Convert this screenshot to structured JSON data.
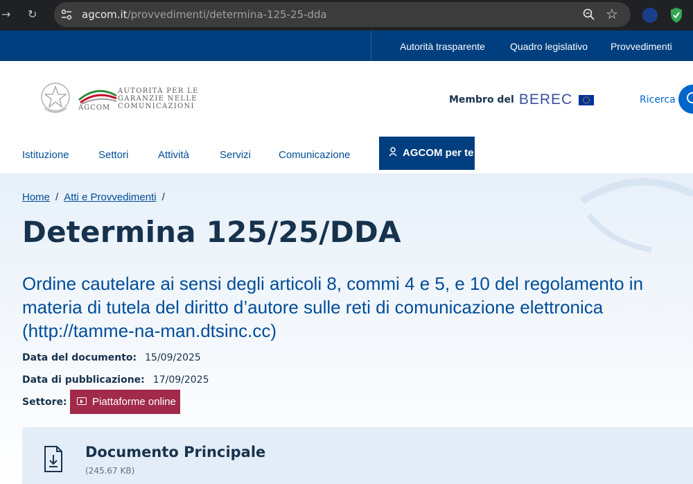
{
  "browser": {
    "url_host": "agcom.it",
    "url_path": "/provvedimenti/determina-125-25-dda"
  },
  "topbar": {
    "links": [
      "Autorità trasparente",
      "Quadro legislativo",
      "Provvedimenti"
    ]
  },
  "header": {
    "logo_lines": [
      "AUTORITÀ PER LE",
      "GARANZIE NELLE",
      "COMUNICAZIONI"
    ],
    "logo_acronym": "AGCOM",
    "berec_label": "Membro del",
    "berec_logo": "BEREC",
    "search_label": "Ricerca"
  },
  "nav": {
    "items": [
      "Istituzione",
      "Settori",
      "Attività",
      "Servizi",
      "Comunicazione"
    ],
    "cta": "AGCOM per te"
  },
  "breadcrumb": {
    "home": "Home",
    "section": "Atti e Provvedimenti",
    "separator": "/"
  },
  "page": {
    "title": "Determina 125/25/DDA",
    "subtitle": "Ordine cautelare ai sensi degli articoli 8, commi 4 e 5, e 10 del regolamento in materia di tutela del diritto d’autore sulle reti di comunicazione elettronica (http://tamme-na-man.dtsinc.cc)",
    "date_label": "Data del documento:",
    "date_value": "15/09/2025",
    "pub_label": "Data di pubblicazione:",
    "pub_value": "17/09/2025",
    "sector_label": "Settore:",
    "sector_value": "Piattaforme online"
  },
  "document": {
    "title": "Documento Principale",
    "size": "(245.67 KB)"
  },
  "colors": {
    "primary": "#003f7f",
    "link": "#004d99",
    "text": "#17324d",
    "sector_badge": "#a12a4b"
  }
}
